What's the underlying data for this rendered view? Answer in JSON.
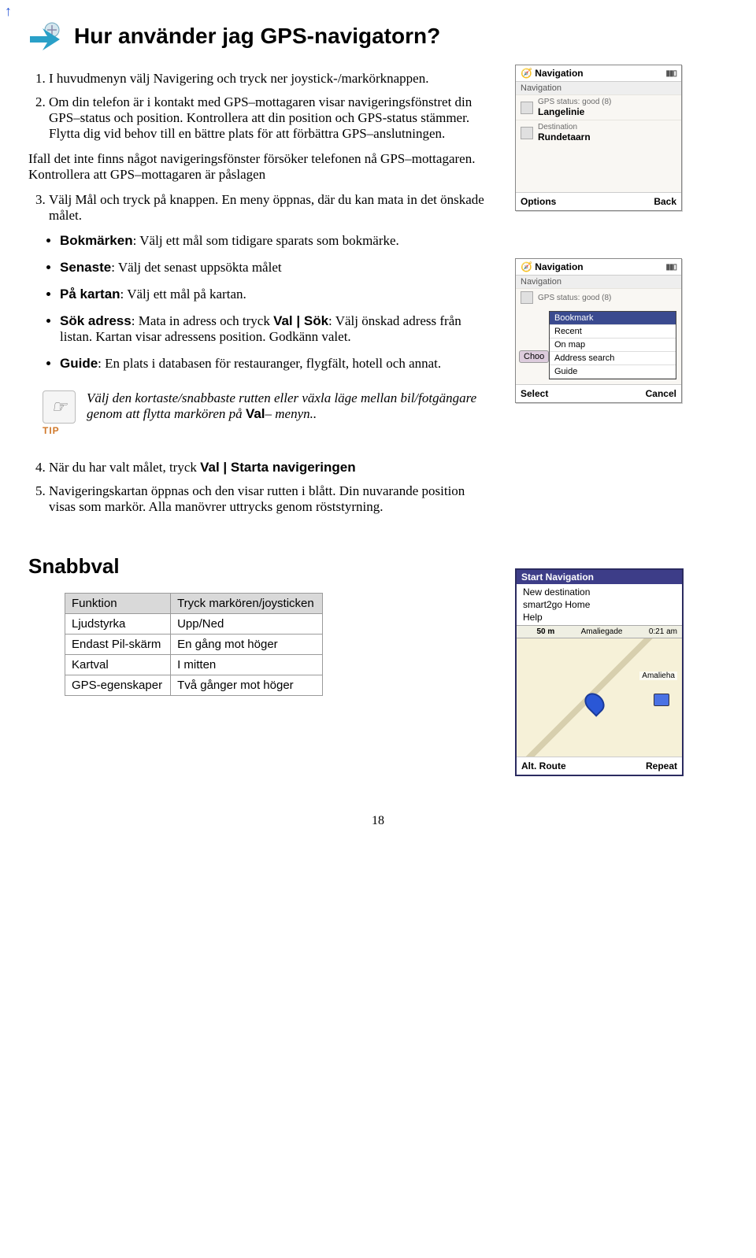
{
  "title": "Hur använder jag GPS-navigatorn?",
  "intro": {
    "step1": "I huvudmenyn välj Navigering och tryck ner joystick-/markörknappen.",
    "step2": "Om din telefon är i kontakt med GPS–mottagaren visar navigeringsfönstret din GPS–status och position. Kontrollera att din position och GPS-status stämmer. Flytta dig vid behov till en bättre plats för att förbättra GPS–anslutningen.",
    "fallback": "Ifall det inte finns något navigeringsfönster försöker telefonen nå GPS–mottagaren. Kontrollera att GPS–mottagaren är påslagen",
    "step3": "Välj Mål och tryck på knappen. En meny öppnas, där du kan mata in det önskade målet."
  },
  "bullets": {
    "b1_term": "Bokmärken",
    "b1_rest": ": Välj ett mål som tidigare sparats som bokmärke.",
    "b2_term": "Senaste",
    "b2_rest": ": Välj det senast uppsökta målet",
    "b3_term": "På kartan",
    "b3_rest": ": Välj ett mål på kartan.",
    "b4_term": "Sök adress",
    "b4_mid": ": Mata in adress och tryck ",
    "b4_val": "Val | Sök",
    "b4_rest": ": Välj önskad adress från listan. Kartan visar adressens position. Godkänn valet.",
    "b5_term": "Guide",
    "b5_rest": ": En plats i databasen för restauranger, flygfält, hotell och annat."
  },
  "tip": {
    "label": "TIP",
    "text_a": "Välj den kortaste/snabbaste rutten eller växla läge mellan bil/fotgängare genom att flytta markören på ",
    "text_b": "Val",
    "text_c": "– menyn.."
  },
  "steps45": {
    "s4a": "När du har valt målet, tryck ",
    "s4b": "Val | Starta navigeringen",
    "s5": "Navigeringskartan öppnas och den visar rutten i blått. Din nuvarande position visas som markör. Alla manövrer uttrycks genom röststyrning."
  },
  "snabbval": {
    "heading": "Snabbval",
    "head_col1": "Funktion",
    "head_col2": "Tryck markören/joysticken",
    "rows": [
      {
        "f": "Ljudstyrka",
        "a": "Upp/Ned"
      },
      {
        "f": "Endast Pil-skärm",
        "a": "En gång mot höger"
      },
      {
        "f": "Kartval",
        "a": "I mitten"
      },
      {
        "f": "GPS-egenskaper",
        "a": "Två gånger mot höger"
      }
    ]
  },
  "phone1": {
    "title": "Navigation",
    "sub": "Navigation",
    "gps_label": "GPS status: good (8)",
    "loc": "Langelinie",
    "dest_label": "Destination",
    "dest": "Rundetaarn",
    "left": "Options",
    "right": "Back"
  },
  "phone2": {
    "title": "Navigation",
    "sub": "Navigation",
    "gps_label": "GPS status: good (8)",
    "menu": [
      "Bookmark",
      "Recent",
      "On map",
      "Address search",
      "Guide"
    ],
    "chip": "Choo",
    "left": "Select",
    "right": "Cancel"
  },
  "phone3": {
    "top": "Start Navigation",
    "items": [
      "New destination",
      "smart2go Home",
      "Help"
    ],
    "dist": "50 m",
    "street": "Amaliegade",
    "time": "0:21 am",
    "road": "Amalieha",
    "left": "Alt. Route",
    "right": "Repeat"
  },
  "page_number": "18"
}
